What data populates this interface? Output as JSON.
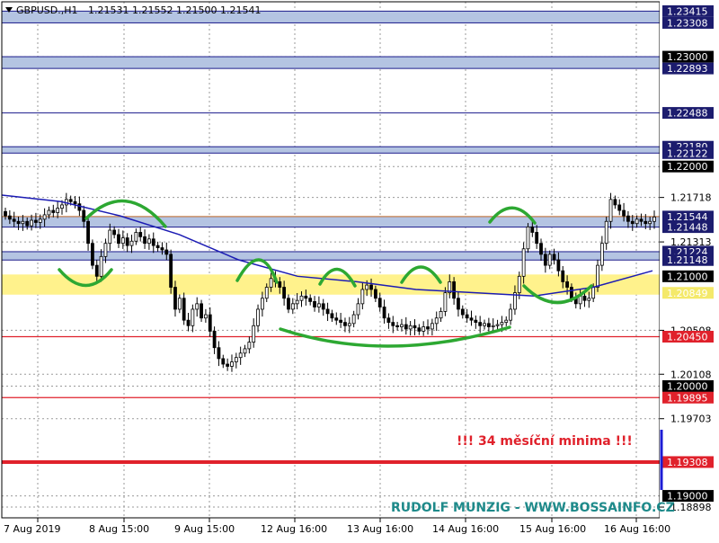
{
  "window": {
    "symbol_title": "GBPUSD.,H1",
    "ohlc": "1.21531 1.21552 1.21500 1.21541"
  },
  "colors": {
    "background": "#ffffff",
    "grid": "#9a9a9a",
    "candle": "#000000",
    "moving_average": "#1c1cb4",
    "zone_fill": "#b4c4e2",
    "zone_border": "#1c1c8c",
    "yellow_zone": "#fff28c",
    "red_line": "#e0212b",
    "pattern_arc": "#2da832",
    "annotation": "#e0212b",
    "watermark": "#1e8a8a",
    "price_tag_bg": "#1c1c6e",
    "current_price_tag_bg": "#000000"
  },
  "annotation_text": "!!!   34 měsíční minima   !!!",
  "watermark_text": "RUDOLF MUNZIG - WWW.BOSSAINFO.CZ",
  "chart_data": {
    "type": "candlestick",
    "symbol": "GBPUSD.",
    "timeframe": "H1",
    "ylim": [
      1.188,
      1.235
    ],
    "x_ticks": [
      "7 Aug 2019",
      "8 Aug 15:00",
      "9 Aug 15:00",
      "12 Aug 16:00",
      "13 Aug 16:00",
      "14 Aug 16:00",
      "15 Aug 16:00",
      "16 Aug 16:00"
    ],
    "y_ticks": [
      "1.21718",
      "1.21313",
      "1.20508",
      "1.20108",
      "1.19703",
      "1.18898"
    ],
    "price_tags": [
      {
        "value": 1.23415,
        "label": "1.23415",
        "style": "level"
      },
      {
        "value": 1.23308,
        "label": "1.23308",
        "style": "level"
      },
      {
        "value": 1.23,
        "label": "1.23000",
        "style": "round"
      },
      {
        "value": 1.22893,
        "label": "1.22893",
        "style": "level"
      },
      {
        "value": 1.22488,
        "label": "1.22488",
        "style": "level"
      },
      {
        "value": 1.2218,
        "label": "1.22180",
        "style": "level"
      },
      {
        "value": 1.22122,
        "label": "1.22122",
        "style": "level"
      },
      {
        "value": 1.22,
        "label": "1.22000",
        "style": "round"
      },
      {
        "value": 1.21544,
        "label": "1.21544",
        "style": "level"
      },
      {
        "value": 1.21448,
        "label": "1.21448",
        "style": "level"
      },
      {
        "value": 1.21224,
        "label": "1.21224",
        "style": "level"
      },
      {
        "value": 1.21148,
        "label": "1.21148",
        "style": "level"
      },
      {
        "value": 1.21,
        "label": "1.21000",
        "style": "round"
      },
      {
        "value": 1.20849,
        "label": "1.20849",
        "style": "yellow"
      },
      {
        "value": 1.2045,
        "label": "1.20450",
        "style": "red"
      },
      {
        "value": 1.2,
        "label": "1.20000",
        "style": "round"
      },
      {
        "value": 1.19895,
        "label": "1.19895",
        "style": "red"
      },
      {
        "value": 1.19308,
        "label": "1.19308",
        "style": "red"
      },
      {
        "value": 1.19,
        "label": "1.19000",
        "style": "round"
      }
    ],
    "zones": [
      {
        "low": 1.23308,
        "high": 1.23415,
        "kind": "blue"
      },
      {
        "low": 1.22893,
        "high": 1.23,
        "kind": "blue"
      },
      {
        "low": 1.22122,
        "high": 1.2218,
        "kind": "blue"
      },
      {
        "low": 1.21448,
        "high": 1.21544,
        "kind": "blue"
      },
      {
        "low": 1.21148,
        "high": 1.21224,
        "kind": "blue"
      },
      {
        "low": 1.20849,
        "high": 1.21,
        "kind": "yellow"
      }
    ],
    "horizontal_lines": [
      {
        "value": 1.22488,
        "kind": "blue"
      },
      {
        "value": 1.2045,
        "kind": "red"
      },
      {
        "value": 1.19895,
        "kind": "red"
      },
      {
        "value": 1.19308,
        "kind": "red-thick"
      }
    ],
    "close_series": [
      1.2155,
      1.2152,
      1.215,
      1.2148,
      1.215,
      1.2146,
      1.2151,
      1.2149,
      1.2152,
      1.2156,
      1.216,
      1.2158,
      1.2162,
      1.2165,
      1.217,
      1.2168,
      1.2166,
      1.216,
      1.215,
      1.213,
      1.211,
      1.21,
      1.2118,
      1.213,
      1.2142,
      1.2138,
      1.213,
      1.2135,
      1.2128,
      1.2132,
      1.214,
      1.2136,
      1.213,
      1.2134,
      1.2128,
      1.2126,
      1.2124,
      1.212,
      1.209,
      1.207,
      1.208,
      1.206,
      1.2055,
      1.207,
      1.2075,
      1.2062,
      1.2065,
      1.205,
      1.2035,
      1.2025,
      1.202,
      1.2018,
      1.2022,
      1.2026,
      1.203,
      1.2034,
      1.204,
      1.2055,
      1.207,
      1.208,
      1.209,
      1.2098,
      1.2095,
      1.209,
      1.208,
      1.207,
      1.2075,
      1.2078,
      1.2082,
      1.208,
      1.2077,
      1.2072,
      1.2075,
      1.207,
      1.2066,
      1.2062,
      1.206,
      1.2058,
      1.2055,
      1.2057,
      1.2065,
      1.2075,
      1.2088,
      1.2092,
      1.2088,
      1.208,
      1.2072,
      1.2062,
      1.2058,
      1.2055,
      1.2054,
      1.2056,
      1.2052,
      1.2055,
      1.2053,
      1.205,
      1.2054,
      1.2052,
      1.2057,
      1.2062,
      1.2068,
      1.2085,
      1.2095,
      1.208,
      1.207,
      1.2065,
      1.2062,
      1.206,
      1.2058,
      1.2055,
      1.2057,
      1.2054,
      1.2055,
      1.2056,
      1.2058,
      1.206,
      1.207,
      1.2085,
      1.21,
      1.2125,
      1.2145,
      1.214,
      1.213,
      1.212,
      1.211,
      1.212,
      1.2115,
      1.2105,
      1.2095,
      1.209,
      1.208,
      1.2075,
      1.2082,
      1.2078,
      1.208,
      1.209,
      1.211,
      1.213,
      1.215,
      1.217,
      1.2165,
      1.216,
      1.2155,
      1.215,
      1.2148,
      1.2152,
      1.215,
      1.2148,
      1.215,
      1.2154
    ],
    "moving_average": {
      "name": "",
      "values_sampled": [
        1.2174,
        1.2168,
        1.2155,
        1.2138,
        1.2115,
        1.21,
        1.2095,
        1.2088,
        1.2085,
        1.2082,
        1.209,
        1.2105
      ]
    },
    "grid": true
  }
}
